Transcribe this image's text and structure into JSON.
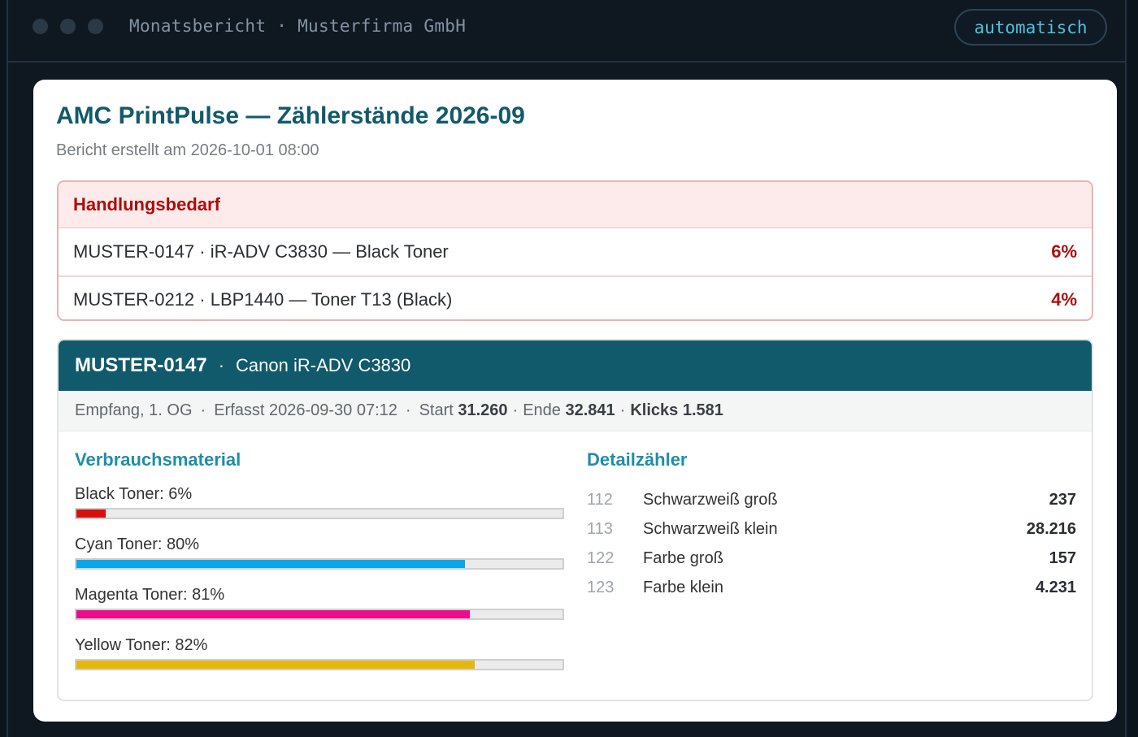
{
  "window": {
    "title": "Monatsbericht · Musterfirma GmbH",
    "badge": "automatisch"
  },
  "report": {
    "title": "AMC PrintPulse — Zählerstände 2026-09",
    "subtitle": "Bericht erstellt am 2026-10-01 08:00"
  },
  "alerts": {
    "heading": "Handlungsbedarf",
    "items": [
      {
        "text": "MUSTER-0147 · iR-ADV C3830 — Black Toner",
        "pct": "6%"
      },
      {
        "text": "MUSTER-0212 · LBP1440 — Toner T13 (Black)",
        "pct": "4%"
      }
    ]
  },
  "device": {
    "id": "MUSTER-0147",
    "separator": "·",
    "model": "Canon iR-ADV C3830",
    "location": "Empfang, 1. OG",
    "recorded": "Erfasst 2026-09-30 07:12",
    "start_label": "Start",
    "start_value": "31.260",
    "end_label": "Ende",
    "end_value": "32.841",
    "clicks": "Klicks 1.581",
    "supplies_title": "Verbrauchsmaterial",
    "supplies": [
      {
        "label": "Black Toner: 6%",
        "level": 0.06,
        "color": "#d80f0f"
      },
      {
        "label": "Cyan Toner: 80%",
        "level": 0.8,
        "color": "#0aa6e6"
      },
      {
        "label": "Magenta Toner: 81%",
        "level": 0.81,
        "color": "#ec0c8c"
      },
      {
        "label": "Yellow Toner: 82%",
        "level": 0.82,
        "color": "#e6b70b"
      }
    ],
    "counters_title": "Detailzähler",
    "counters": [
      {
        "code": "112",
        "name": "Schwarzweiß groß",
        "value": "237"
      },
      {
        "code": "113",
        "name": "Schwarzweiß klein",
        "value": "28.216"
      },
      {
        "code": "122",
        "name": "Farbe groß",
        "value": "157"
      },
      {
        "code": "123",
        "name": "Farbe klein",
        "value": "4.231"
      }
    ]
  }
}
